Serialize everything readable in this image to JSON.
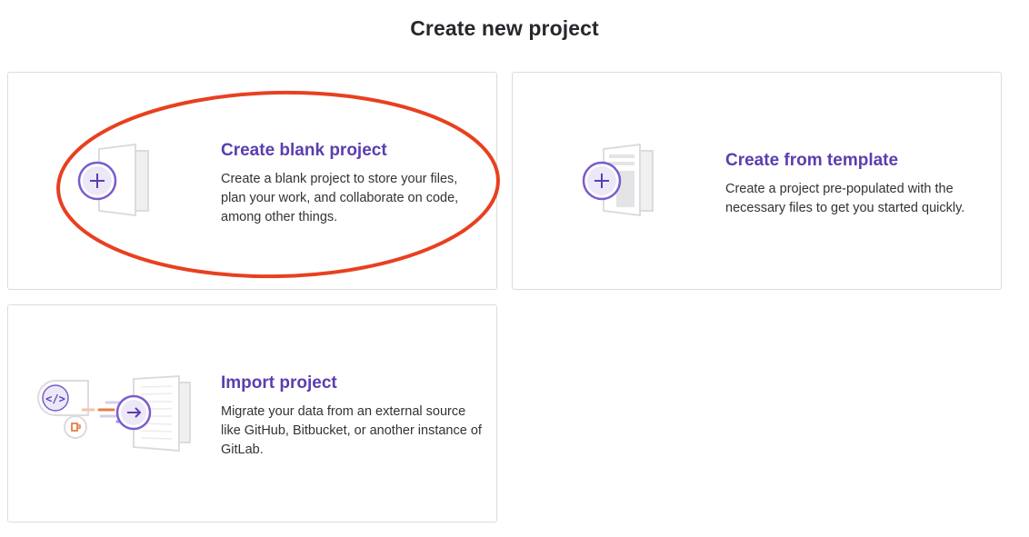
{
  "header": {
    "title": "Create new project"
  },
  "cards": [
    {
      "title": "Create blank project",
      "description": "Create a blank project to store your files, plan your work, and collaborate on code, among other things.",
      "icon": "blank-project-icon"
    },
    {
      "title": "Create from template",
      "description": "Create a project pre-populated with the necessary files to get you started quickly.",
      "icon": "template-project-icon"
    },
    {
      "title": "Import project",
      "description": "Migrate your data from an external source like GitHub, Bitbucket, or another instance of GitLab.",
      "icon": "import-project-icon"
    }
  ],
  "colors": {
    "accent": "#5b3eaf",
    "annotation": "#e8401f",
    "border": "#dcdcde"
  }
}
